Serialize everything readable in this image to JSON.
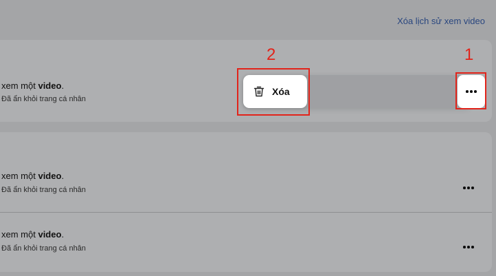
{
  "header": {
    "clear_history_label": "Xóa lịch sử xem video"
  },
  "entries": [
    {
      "title_prefix": "xem một ",
      "title_bold": "video",
      "title_suffix": ".",
      "subtitle": "Đã ẩn khỏi trang cá nhân"
    },
    {
      "title_prefix": "xem một ",
      "title_bold": "video",
      "title_suffix": ".",
      "subtitle": "Đã ẩn khỏi trang cá nhân"
    },
    {
      "title_prefix": "xem một ",
      "title_bold": "video",
      "title_suffix": ".",
      "subtitle": "Đã ẩn khỏi trang cá nhân"
    }
  ],
  "context_menu": {
    "delete_label": "Xóa",
    "delete_icon": "trash-icon"
  },
  "annotations": {
    "step1": "1",
    "step2": "2",
    "highlight_color": "#e2231a"
  },
  "colors": {
    "page_bg": "#a4a5a7",
    "card_bg": "#aeafb1",
    "link": "#29467f"
  }
}
